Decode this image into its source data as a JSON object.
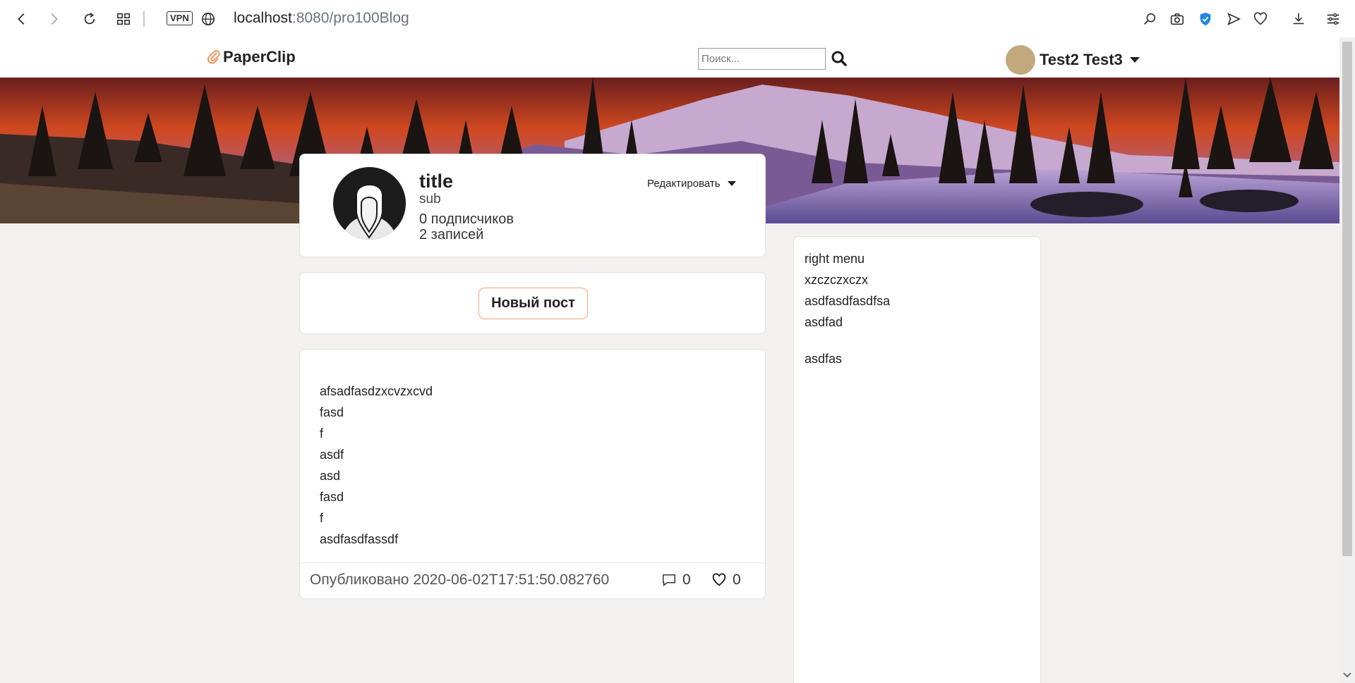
{
  "browser": {
    "vpn_label": "VPN",
    "url_host": "localhost",
    "url_path": ":8080/pro100Blog"
  },
  "header": {
    "logo_text": "PaperClip",
    "search_placeholder": "Поиск...",
    "user_name": "Test2 Test3"
  },
  "profile": {
    "title": "title",
    "subtitle": "sub",
    "followers": "0 подписчиков",
    "posts": "2 записей",
    "edit_label": "Редактировать"
  },
  "new_post": {
    "label": "Новый пост"
  },
  "post": {
    "lines": [
      "afsadfasdzxcvzxcvd",
      "fasd",
      "f",
      "asdf",
      "asd",
      "fasd",
      "f",
      "asdfasdfassdf"
    ],
    "published": "Опубликовано 2020-06-02T17:51:50.082760",
    "comments": "0",
    "likes": "0"
  },
  "right_menu": {
    "lines": [
      "right menu",
      "xzczczxczx",
      "asdfasdfasdfsa",
      "asdfad"
    ],
    "extra": "asdfas"
  },
  "colors": {
    "accent_border": "#f0a57a",
    "avatar_bg": "#c2a87d",
    "tracker_blue": "#1e88e5"
  }
}
